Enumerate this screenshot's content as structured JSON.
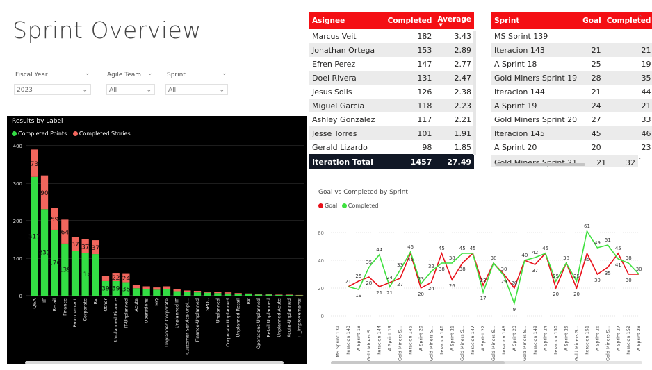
{
  "page": {
    "title": "Sprint Overview"
  },
  "slicers": [
    {
      "label": "Fiscal Year",
      "value": "2023"
    },
    {
      "label": "Agile Team",
      "value": "All"
    },
    {
      "label": "Sprint",
      "value": "All"
    }
  ],
  "assignee_table": {
    "headers": [
      "Asignee",
      "Completed",
      "Average"
    ],
    "rows": [
      [
        "Marcus Veit",
        "182",
        "3.43"
      ],
      [
        "Jonathan Ortega",
        "153",
        "2.89"
      ],
      [
        "Efren Perez",
        "147",
        "2.77"
      ],
      [
        "Doel Rivera",
        "131",
        "2.47"
      ],
      [
        "Jesus Solis",
        "126",
        "2.38"
      ],
      [
        "Miguel Garcia",
        "118",
        "2.23"
      ],
      [
        "Ashley Gonzalez",
        "117",
        "2.21"
      ],
      [
        "Jesse Torres",
        "101",
        "1.91"
      ],
      [
        "Gerald Lizardo",
        "98",
        "1.85"
      ]
    ],
    "total": [
      "Iteration Total",
      "1457",
      "27.49"
    ]
  },
  "sprint_table": {
    "headers": [
      "Sprint",
      "Goal",
      "Completed"
    ],
    "rows": [
      [
        "MS Sprint 139",
        "",
        ""
      ],
      [
        "Iteracion 143",
        "21",
        "21"
      ],
      [
        "A Sprint 18",
        "25",
        "19"
      ],
      [
        "Gold Miners Sprint 19",
        "28",
        "35"
      ],
      [
        "Iteracion 144",
        "21",
        "44"
      ],
      [
        "A Sprint 19",
        "24",
        "21"
      ],
      [
        "Gold Miners Sprint 20",
        "27",
        "33"
      ],
      [
        "Iteracion 145",
        "45",
        "46"
      ],
      [
        "A Sprint 20",
        "20",
        "23"
      ]
    ],
    "partial_row": [
      "Gold Miners Sprint 21",
      "21",
      "32"
    ]
  },
  "chart_data": [
    {
      "type": "bar",
      "title": "Results by Label",
      "stacked": true,
      "categories": [
        "Q&A",
        "IT",
        "Retail",
        "Finance",
        "Procurement",
        "Corporate",
        "Rx",
        "Other",
        "Unplanned Finance",
        "IT-Unplanned",
        "Acute",
        "Operations",
        "MQ",
        "Unplanned Corporate",
        "Unplanned IT",
        "Customer Service Unpl...",
        "Finance-Unplanned",
        "SPOC",
        "Unplanned",
        "Corporate Unplanned",
        "Unplanned Retail",
        "Rx",
        "Operations Unplanned",
        "Retail Unplanned",
        "Unplanned Acute",
        "Acute-Unplanned",
        "IT_improvements"
      ],
      "series": [
        {
          "name": "Completed Points",
          "color": "#33dd44",
          "values": [
            317,
            231,
            176,
            139,
            120,
            114,
            111,
            39,
            39,
            36,
            20,
            18,
            16,
            18,
            12,
            10,
            9,
            8,
            7,
            6,
            5,
            4,
            3,
            3,
            2,
            2,
            1
          ]
        },
        {
          "name": "Completed Stories",
          "color": "#f2665d",
          "values": [
            73,
            90,
            59,
            64,
            37,
            37,
            37,
            14,
            22,
            24,
            8,
            7,
            6,
            7,
            5,
            4,
            4,
            3,
            3,
            3,
            2,
            2,
            1,
            1,
            1,
            1,
            1
          ]
        }
      ],
      "point_labels": [
        "317",
        "231",
        "176",
        "139",
        "",
        "114",
        "",
        "39",
        "39",
        "36"
      ],
      "story_labels": [
        "73",
        "90",
        "59",
        "64",
        "37",
        "37",
        "37",
        "",
        "22",
        "24"
      ],
      "ylim": [
        0,
        400
      ],
      "yticks": [
        0,
        100,
        200,
        300,
        400
      ],
      "legend": "top-left",
      "grid": true
    },
    {
      "type": "line",
      "title": "Goal vs Completed by Sprint",
      "categories": [
        "MS Sprint 139",
        "Iteracion 143",
        "A Sprint 18",
        "Gold Miners S...",
        "Iteracion 144",
        "A Sprint 19",
        "Gold Miners S...",
        "Iteracion 145",
        "A Sprint 20",
        "Gold Miners S...",
        "Iteracion 146",
        "A Sprint 21",
        "Gold Miners S...",
        "Iteracion 147",
        "A Sprint 22",
        "Gold Miners S...",
        "Iteracion 148",
        "A Sprint 23",
        "Gold Miners S...",
        "Iteracion 149",
        "A Sprint 24",
        "Iteracion 150",
        "A Sprint 25",
        "Gold Miners S...",
        "Iteracion 151",
        "A Sprint 26",
        "Gold Miners S...",
        "A Sprint 27",
        "Iteracion 152",
        "A Sprint 28"
      ],
      "series": [
        {
          "name": "Goal",
          "color": "#e8111a",
          "values": [
            null,
            21,
            25,
            28,
            21,
            24,
            27,
            45,
            20,
            24,
            45,
            26,
            38,
            45,
            22,
            38,
            30,
            20,
            40,
            37,
            45,
            20,
            38,
            20,
            45,
            30,
            35,
            45,
            30,
            30
          ]
        },
        {
          "name": "Completed",
          "color": "#3fe13f",
          "values": [
            null,
            21,
            19,
            35,
            44,
            21,
            33,
            46,
            23,
            32,
            38,
            38,
            45,
            45,
            17,
            38,
            29,
            9,
            40,
            42,
            45,
            25,
            38,
            25,
            61,
            49,
            51,
            41,
            38,
            30
          ]
        }
      ],
      "ylim": [
        0,
        70
      ],
      "yticks": [
        0,
        20,
        40,
        60
      ],
      "legend": "top-left",
      "grid": true
    }
  ]
}
